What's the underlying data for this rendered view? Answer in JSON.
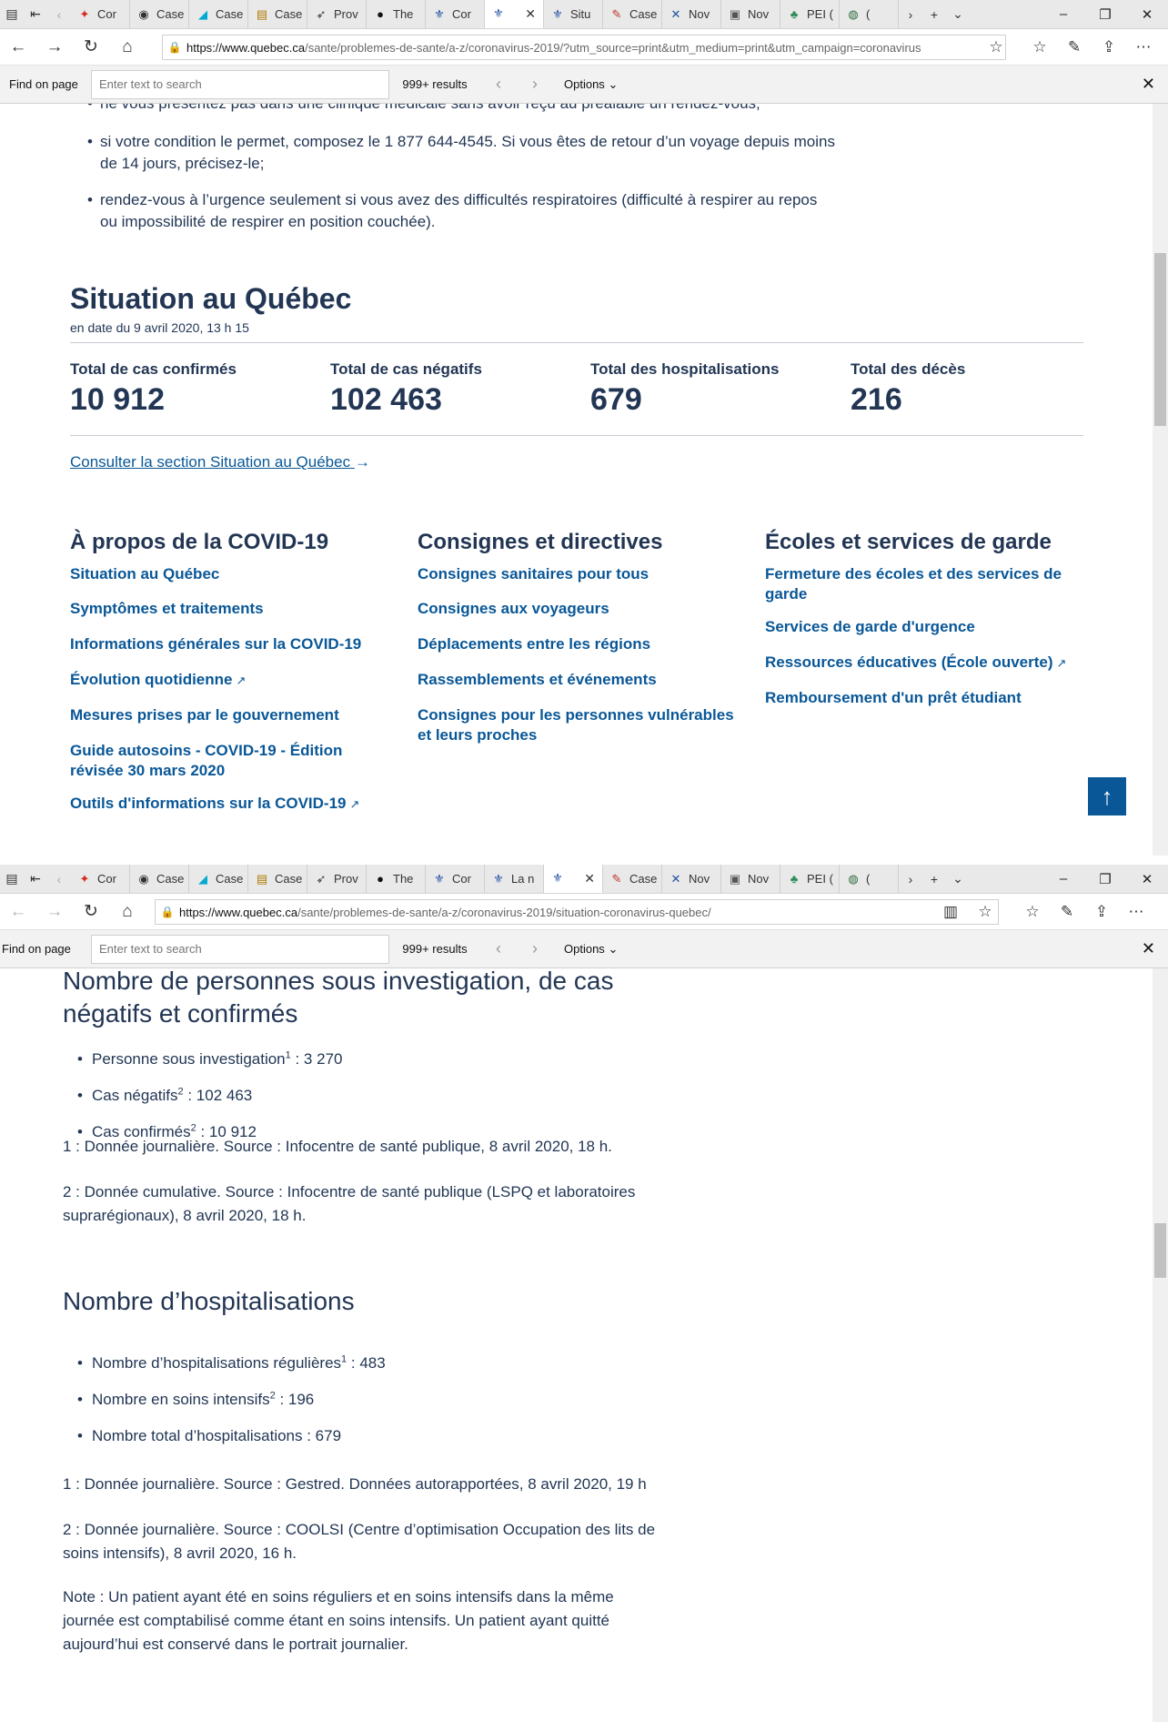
{
  "window1": {
    "tabs": [
      {
        "label": "Cor",
        "icon": "maple-leaf-icon",
        "color": "#d52b1e"
      },
      {
        "label": "Case",
        "icon": "cbc-icon",
        "color": "#333333"
      },
      {
        "label": "Case",
        "icon": "alberta-icon",
        "color": "#00aad2"
      },
      {
        "label": "Case",
        "icon": "document-icon",
        "color": "#b07a00"
      },
      {
        "label": "Prov",
        "icon": "bird-icon",
        "color": "#333333"
      },
      {
        "label": "The",
        "icon": "circle-logo-icon",
        "color": "#111111"
      },
      {
        "label": "Cor",
        "icon": "quebec-flag-icon",
        "color": "#1f4fa0"
      },
      {
        "label": "",
        "icon": "quebec-flag-icon",
        "color": "#1f4fa0",
        "active": true
      },
      {
        "label": "Situ",
        "icon": "quebec-flag-icon",
        "color": "#1f4fa0"
      },
      {
        "label": "Case",
        "icon": "pdf-icon",
        "color": "#c0392b"
      },
      {
        "label": "Nov",
        "icon": "ns-flag-icon",
        "color": "#1f4fa0"
      },
      {
        "label": "Nov",
        "icon": "ns-icon",
        "color": "#555555"
      },
      {
        "label": "PEI (",
        "icon": "pei-icon",
        "color": "#2e8b57"
      },
      {
        "label": "(",
        "icon": "globe-icon",
        "color": "#2e6b3a"
      }
    ],
    "url_host": "https://www.quebec.ca",
    "url_path": "/sante/problemes-de-sante/a-z/coronavirus-2019/?utm_source=print&utm_medium=print&utm_campaign=coronavirus",
    "find": {
      "label": "Find on page",
      "placeholder": "Enter text to search",
      "results": "999+ results",
      "options": "Options"
    },
    "bullets": [
      "ne vous présentez pas dans une clinique médicale sans avoir reçu au préalable un rendez-vous;",
      "si votre condition le permet, composez le 1 877 644-4545. Si vous êtes de retour d’un voyage depuis moins de 14 jours, précisez-le;",
      "rendez-vous à l’urgence seulement si vous avez des difficultés respiratoires (difficulté à respirer au repos ou impossibilité de respirer en position couchée)."
    ],
    "situation": {
      "title": "Situation au Québec",
      "date": "en date du 9 avril 2020, 13 h 15",
      "stats": [
        {
          "label": "Total de cas confirmés",
          "value": "10 912"
        },
        {
          "label": "Total de cas négatifs",
          "value": "102 463"
        },
        {
          "label": "Total des hospitalisations",
          "value": "679"
        },
        {
          "label": "Total des décès",
          "value": "216"
        }
      ],
      "link": "Consulter la section Situation au Québec"
    },
    "columns": [
      {
        "title": "À propos de la COVID-19",
        "links": [
          {
            "text": "Situation au Québec"
          },
          {
            "text": "Symptômes et traitements"
          },
          {
            "text": "Informations générales sur la COVID-19"
          },
          {
            "text": "Évolution quotidienne",
            "external": true
          },
          {
            "text": "Mesures prises par le gouvernement"
          },
          {
            "text": "Guide autosoins - COVID-19 - Édition révisée 30 mars 2020"
          },
          {
            "text": "Outils d'informations sur la COVID-19",
            "external": true
          }
        ]
      },
      {
        "title": "Consignes et directives",
        "links": [
          {
            "text": "Consignes sanitaires pour tous"
          },
          {
            "text": "Consignes aux voyageurs"
          },
          {
            "text": "Déplacements entre les régions"
          },
          {
            "text": "Rassemblements et événements"
          },
          {
            "text": "Consignes pour les personnes vulnérables et leurs proches"
          }
        ]
      },
      {
        "title": "Écoles et services de garde",
        "links": [
          {
            "text": "Fermeture des écoles et des services de garde"
          },
          {
            "text": "Services de garde d'urgence"
          },
          {
            "text": "Ressources éducatives (École ouverte)",
            "external": true
          },
          {
            "text": "Remboursement d'un prêt étudiant"
          }
        ]
      }
    ]
  },
  "window2": {
    "tabs": [
      {
        "label": "Cor",
        "icon": "maple-leaf-icon",
        "color": "#d52b1e"
      },
      {
        "label": "Case",
        "icon": "cbc-icon",
        "color": "#333333"
      },
      {
        "label": "Case",
        "icon": "alberta-icon",
        "color": "#00aad2"
      },
      {
        "label": "Case",
        "icon": "document-icon",
        "color": "#b07a00"
      },
      {
        "label": "Prov",
        "icon": "bird-icon",
        "color": "#333333"
      },
      {
        "label": "The",
        "icon": "circle-logo-icon",
        "color": "#111111"
      },
      {
        "label": "Cor",
        "icon": "quebec-flag-icon",
        "color": "#1f4fa0"
      },
      {
        "label": "La n",
        "icon": "quebec-flag-icon",
        "color": "#1f4fa0"
      },
      {
        "label": "",
        "icon": "quebec-flag-icon",
        "color": "#1f4fa0",
        "active": true
      },
      {
        "label": "Case",
        "icon": "pdf-icon",
        "color": "#c0392b"
      },
      {
        "label": "Nov",
        "icon": "ns-flag-icon",
        "color": "#1f4fa0"
      },
      {
        "label": "Nov",
        "icon": "ns-icon",
        "color": "#555555"
      },
      {
        "label": "PEI (",
        "icon": "pei-icon",
        "color": "#2e8b57"
      },
      {
        "label": "(",
        "icon": "globe-icon",
        "color": "#2e6b3a"
      }
    ],
    "url_host": "https://www.quebec.ca",
    "url_path": "/sante/problemes-de-sante/a-z/coronavirus-2019/situation-coronavirus-quebec/",
    "find": {
      "label": "Find on page",
      "placeholder": "Enter text to search",
      "results": "999+ results",
      "options": "Options"
    },
    "investigation": {
      "title": "Nombre de personnes sous investigation, de cas négatifs et confirmés",
      "items": [
        {
          "label": "Personne sous investigation",
          "sup": "1",
          "value": " : 3 270"
        },
        {
          "label": "Cas négatifs",
          "sup": "2",
          "value": " : 102 463"
        },
        {
          "label": "Cas confirmés",
          "sup": "2",
          "value": " : 10 912"
        }
      ],
      "notes": [
        "1 : Donnée journalière. Source : Infocentre de santé publique, 8 avril 2020, 18 h.",
        "2 : Donnée cumulative. Source : Infocentre de santé publique (LSPQ et laboratoires suprarégionaux), 8 avril 2020, 18 h."
      ]
    },
    "hospitalisations": {
      "title": "Nombre d’hospitalisations",
      "items": [
        {
          "label": "Nombre d’hospitalisations régulières",
          "sup": "1",
          "value": " : 483"
        },
        {
          "label": "Nombre en soins intensifs",
          "sup": "2",
          "value": " : 196"
        },
        {
          "label": "Nombre total d’hospitalisations : 679",
          "sup": "",
          "value": ""
        }
      ],
      "notes": [
        "1 : Donnée journalière. Source : Gestred. Données autorapportées, 8 avril 2020, 19 h",
        "2 : Donnée journalière. Source : COOLSI (Centre d’optimisation Occupation des lits de soins intensifs), 8 avril 2020, 16 h.",
        "Note : Un patient ayant été en soins réguliers et en soins intensifs dans la même journée est comptabilisé comme étant en soins intensifs. Un patient ayant quitté aujourd’hui est conservé dans le portrait journalier."
      ]
    }
  }
}
